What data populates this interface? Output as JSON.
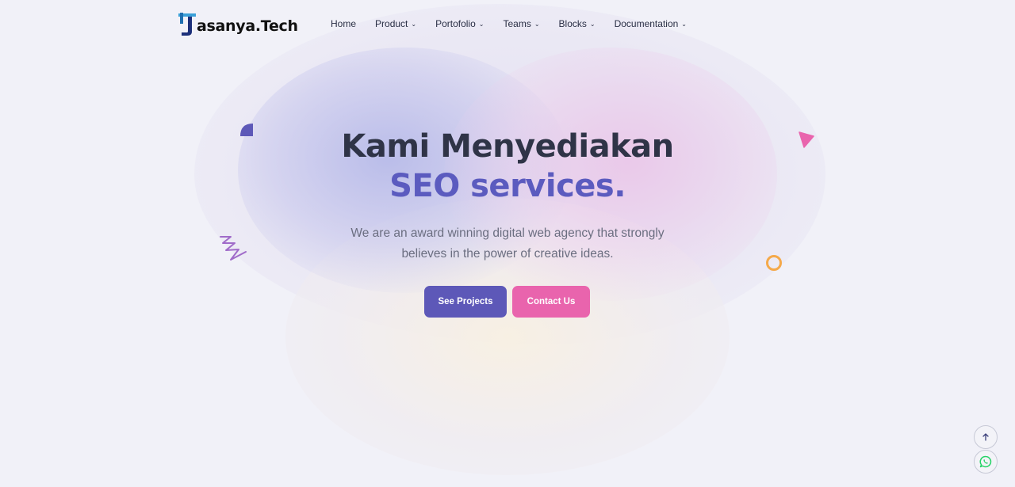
{
  "brand": {
    "name": "asanya.Tech",
    "logo_letter": "J"
  },
  "nav": {
    "items": [
      {
        "label": "Home",
        "has_dropdown": false
      },
      {
        "label": "Product",
        "has_dropdown": true
      },
      {
        "label": "Portofolio",
        "has_dropdown": true
      },
      {
        "label": "Teams",
        "has_dropdown": true
      },
      {
        "label": "Blocks",
        "has_dropdown": true
      },
      {
        "label": "Documentation",
        "has_dropdown": true
      }
    ]
  },
  "hero": {
    "title_line1": "Kami Menyediakan",
    "title_line2": "SEO services.",
    "subtitle_line1": "We are an award winning digital web agency that strongly",
    "subtitle_line2": "believes in the power of creative ideas.",
    "primary_button": "See Projects",
    "secondary_button": "Contact Us"
  },
  "floating": {
    "scroll_top_icon": "arrow-up-icon",
    "whatsapp_icon": "whatsapp-icon"
  },
  "colors": {
    "primary": "#5d58b8",
    "secondary": "#e964ad",
    "accent_orange": "#f5a94a",
    "whatsapp": "#25d366"
  }
}
